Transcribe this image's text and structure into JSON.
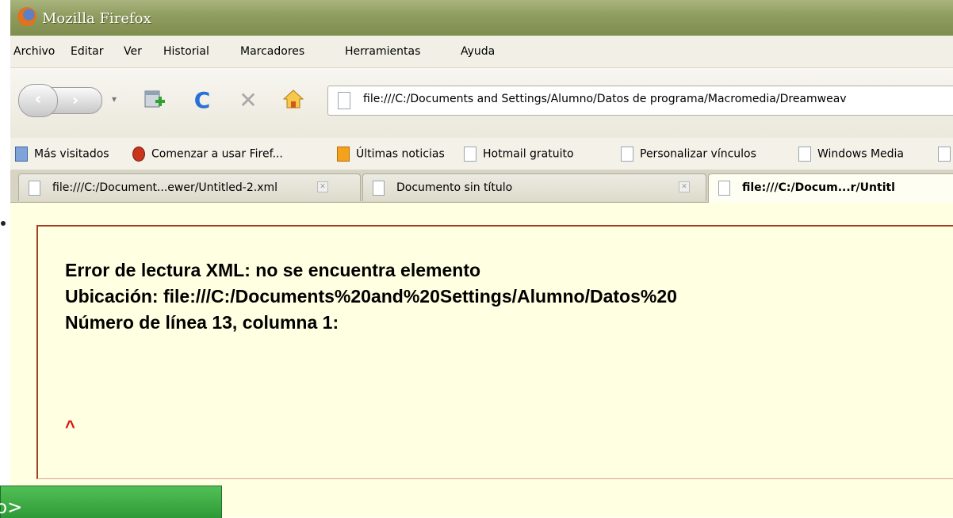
{
  "window": {
    "title": "Mozilla Firefox"
  },
  "menu": [
    "Archivo",
    "Editar",
    "Ver",
    "Historial",
    "Marcadores",
    "Herramientas",
    "Ayuda"
  ],
  "navbar": {
    "url": "file:///C:/Documents and Settings/Alumno/Datos de programa/Macromedia/Dreamweav"
  },
  "bookmarks": [
    "Más visitados",
    "Comenzar a usar Firef...",
    "Últimas noticias",
    "Hotmail gratuito",
    "Personalizar vínculos",
    "Windows Media"
  ],
  "tabs": [
    {
      "label": "file:///C:/Document...ewer/Untitled-2.xml"
    },
    {
      "label": "Documento sin título"
    },
    {
      "label": "file:///C:/Docum...r/Untitl"
    }
  ],
  "error": {
    "line1": "Error de lectura XML: no se encuentra elemento",
    "line2": "Ubicación: file:///C:/Documents%20and%20Settings/Alumno/Datos%20",
    "line3": "Número de línea 13, columna 1:",
    "caret": "^"
  },
  "overlay": {
    "text": "o>"
  },
  "icons": {
    "back": "back-arrow-icon",
    "forward": "forward-arrow-icon",
    "reload": "reload-icon",
    "stop": "stop-icon",
    "home": "home-icon",
    "new_tab": "new-tab-icon"
  }
}
